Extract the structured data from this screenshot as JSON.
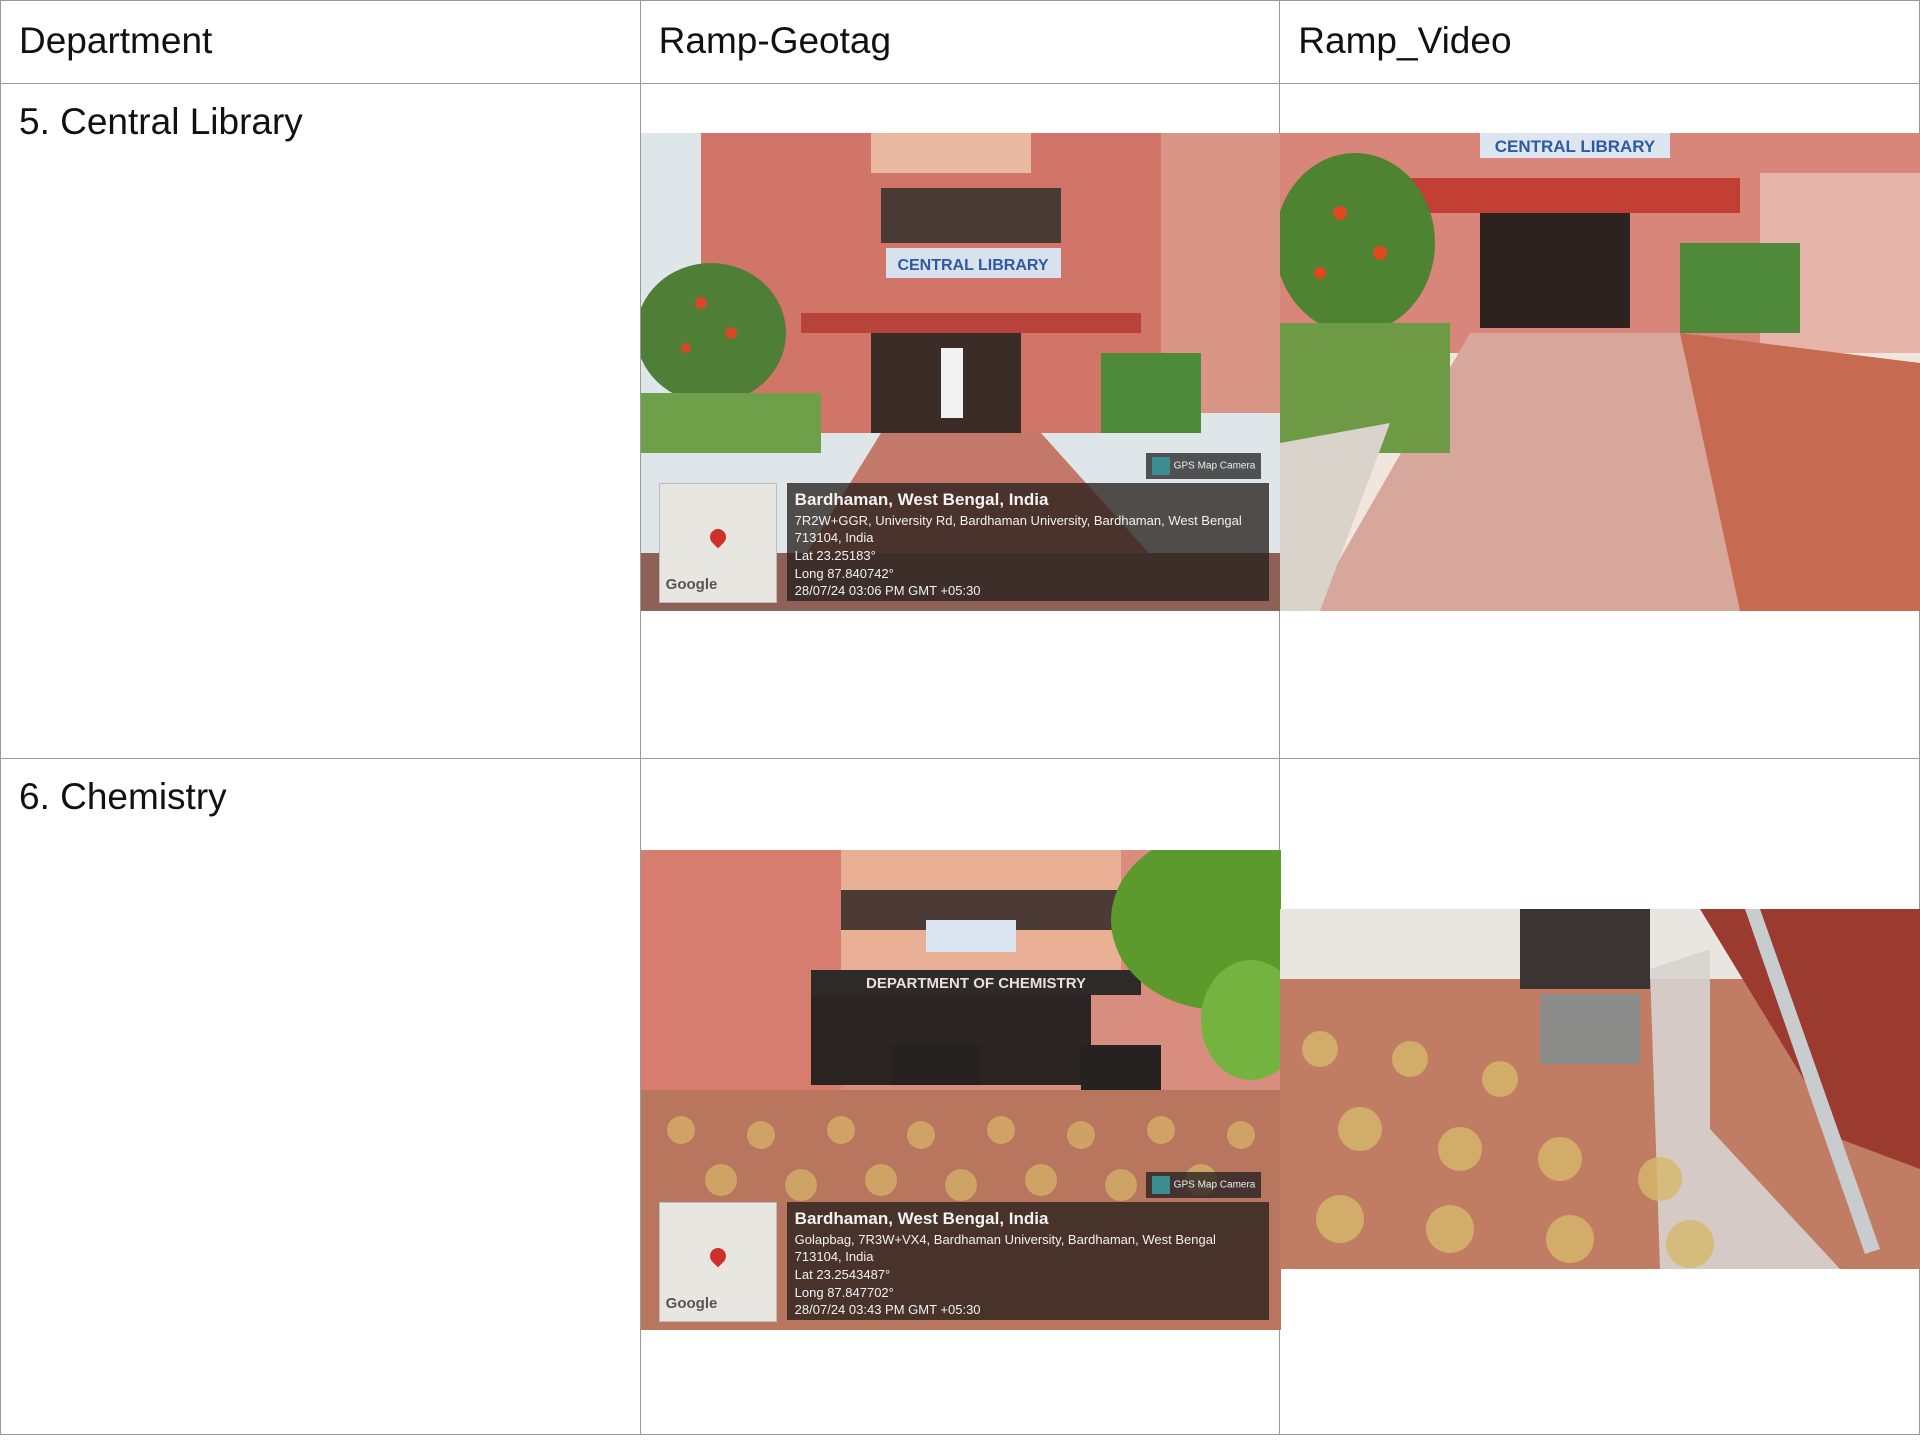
{
  "table": {
    "headers": [
      "Department",
      "Ramp-Geotag",
      "Ramp_Video"
    ],
    "rows": [
      {
        "department": "5. Central Library",
        "geotag": {
          "sign": "CENTRAL LIBRARY",
          "place": "Bardhaman, West Bengal, India",
          "address": "7R2W+GGR, University Rd, Bardhaman University, Bardhaman, West Bengal 713104, India",
          "lat": "Lat 23.25183°",
          "long": "Long 87.840742°",
          "datetime": "28/07/24 03:06 PM GMT +05:30",
          "map_label": "Google",
          "app_badge": "GPS Map Camera"
        },
        "video": {
          "sign": "CENTRAL LIBRARY"
        }
      },
      {
        "department": "6. Chemistry",
        "geotag": {
          "sign": "DEPARTMENT OF CHEMISTRY",
          "place": "Bardhaman, West Bengal, India",
          "address": "Golapbag, 7R3W+VX4, Bardhaman University, Bardhaman, West Bengal 713104, India",
          "lat": "Lat 23.2543487°",
          "long": "Long 87.847702°",
          "datetime": "28/07/24 03:43 PM GMT +05:30",
          "map_label": "Google",
          "app_badge": "GPS Map Camera"
        },
        "video": {}
      }
    ]
  },
  "colors": {
    "border": "#9a9a9a",
    "wall": "#c8685d",
    "overlay": "#2b211d"
  }
}
